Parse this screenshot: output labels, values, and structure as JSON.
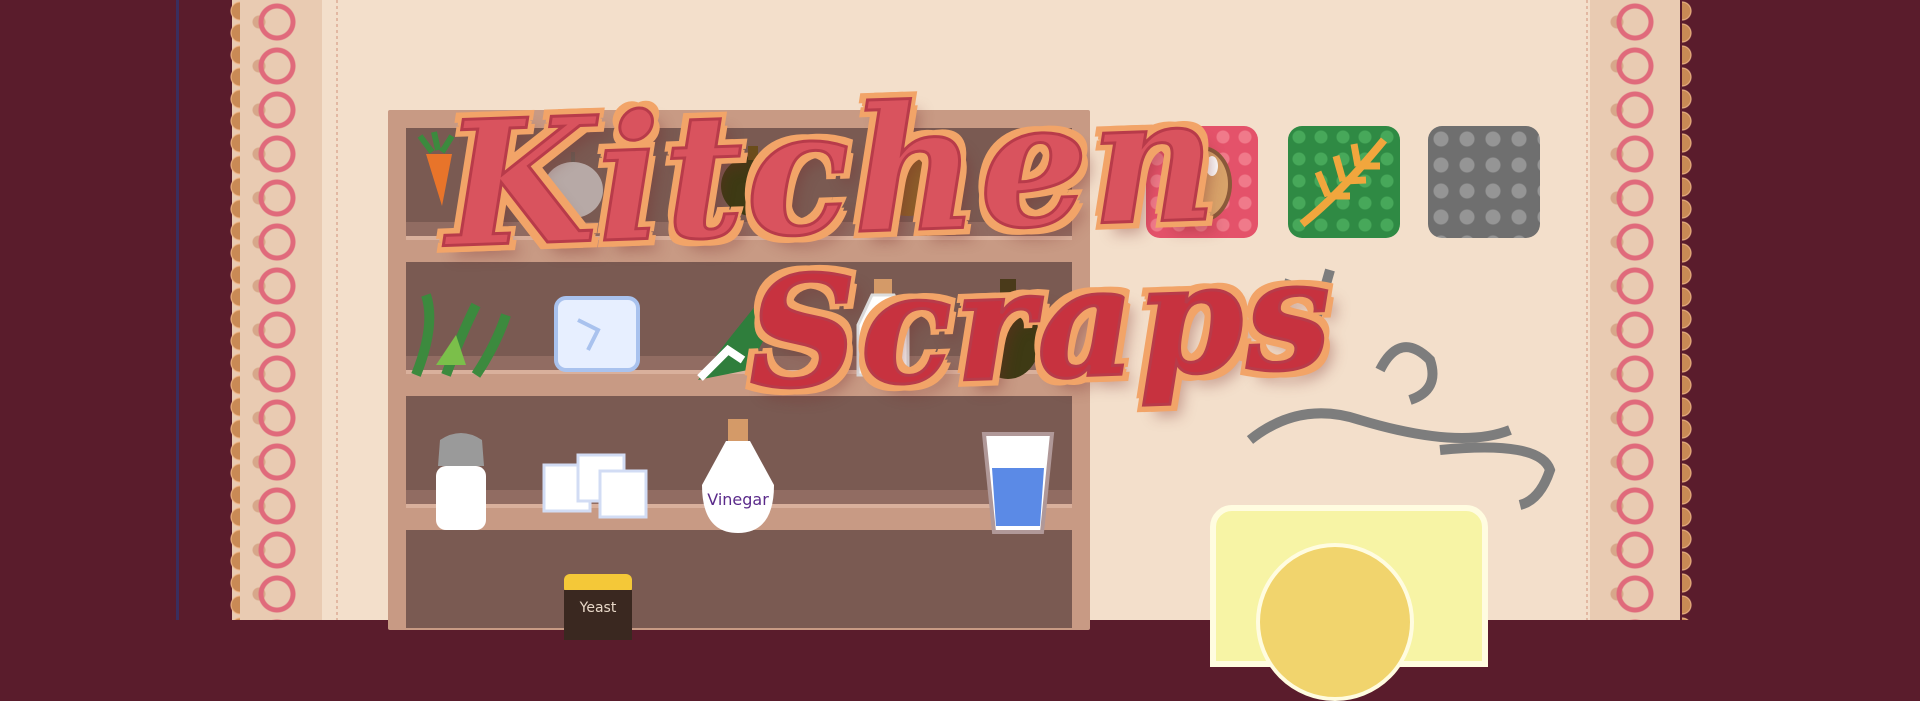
{
  "game": {
    "title_line1": "Kitchen",
    "title_line2": "Scraps"
  },
  "shelf": {
    "labels": {
      "vinegar": "Vinegar",
      "yeast": "Yeast"
    },
    "items": [
      {
        "name": "carrot-icon"
      },
      {
        "name": "onion-icon"
      },
      {
        "name": "pumpkin-icon"
      },
      {
        "name": "potato-icon"
      },
      {
        "name": "herbs-icon"
      },
      {
        "name": "ice-cube-icon"
      },
      {
        "name": "lettuce-icon"
      },
      {
        "name": "milk-bottle-icon"
      },
      {
        "name": "oil-bottle-icon"
      },
      {
        "name": "salt-shaker-icon"
      },
      {
        "name": "sugar-cubes-icon"
      },
      {
        "name": "vinegar-bottle-icon"
      },
      {
        "name": "water-glass-icon"
      },
      {
        "name": "yeast-jar-icon"
      }
    ]
  },
  "tiles": [
    {
      "name": "egg-tile",
      "icon": "egg-icon",
      "color": "#e4526a"
    },
    {
      "name": "wheat-tile",
      "icon": "wheat-icon",
      "color": "#2f8a44"
    },
    {
      "name": "empty-tile",
      "icon": "",
      "color": "#6f6f6f"
    }
  ],
  "colors": {
    "background": "#5a1c2c",
    "paper": "#f3dfcb",
    "title_fill": "#d9535e",
    "title_outline": "#f2a468",
    "shelf": "#c89a84"
  }
}
